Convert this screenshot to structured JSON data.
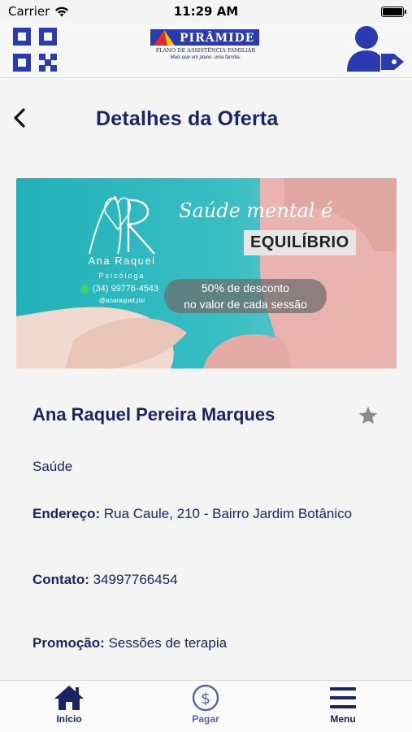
{
  "status_bar": {
    "carrier": "Carrier",
    "time": "11:29 AM"
  },
  "header": {
    "logo_name": "PIRÂMIDE",
    "logo_subtitle": "PLANO DE ASSISTÊNCIA FAMILIAR",
    "logo_tagline": "Mais que um plano, uma família."
  },
  "page": {
    "title": "Detalhes da Oferta"
  },
  "banner": {
    "name": "Ana Raquel",
    "role": "Psicóloga",
    "phone": "(34) 99776-4543",
    "handle": "@anaraquel.psi",
    "script_text": "Saúde mental é",
    "highlight": "EQUILÍBRIO",
    "discount_line1": "50% de desconto",
    "discount_line2": "no valor de cada sessão"
  },
  "offer": {
    "name": "Ana Raquel Pereira Marques",
    "category": "Saúde",
    "address_label": "Endereço:",
    "address": "Rua Caule, 210 - Bairro Jardim Botânico",
    "contact_label": "Contato:",
    "contact": "34997766454",
    "promo_label": "Promoção:",
    "promo": "Sessões de terapia"
  },
  "tab_bar": {
    "items": [
      {
        "label": "Início",
        "icon": "home-icon"
      },
      {
        "label": "Pagar",
        "icon": "dollar-icon"
      },
      {
        "label": "Menu",
        "icon": "hamburger-icon"
      }
    ]
  },
  "colors": {
    "brand_navy": "#1a2566",
    "brand_blue": "#2a3bb0",
    "banner_teal": "#28b5bd"
  }
}
